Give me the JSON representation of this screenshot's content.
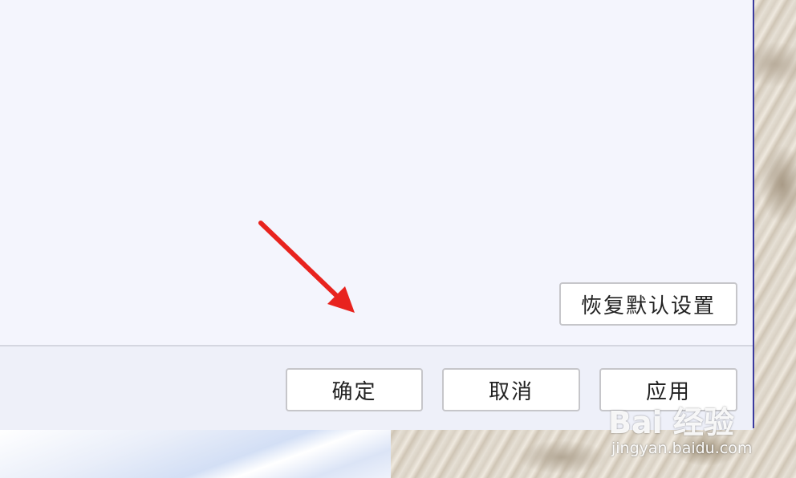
{
  "dialog": {
    "restore_defaults_label": "恢复默认设置",
    "ok_label": "确定",
    "cancel_label": "取消",
    "apply_label": "应用"
  },
  "annotation": {
    "arrow_color": "#e8231e"
  },
  "watermark": {
    "logo_text": "Bai 经验",
    "url_text": "jingyan.baidu.com"
  },
  "colors": {
    "dialog_bg": "#f4f5fd",
    "footer_bg": "#eef0f9",
    "dialog_border": "#3a3a9e"
  }
}
